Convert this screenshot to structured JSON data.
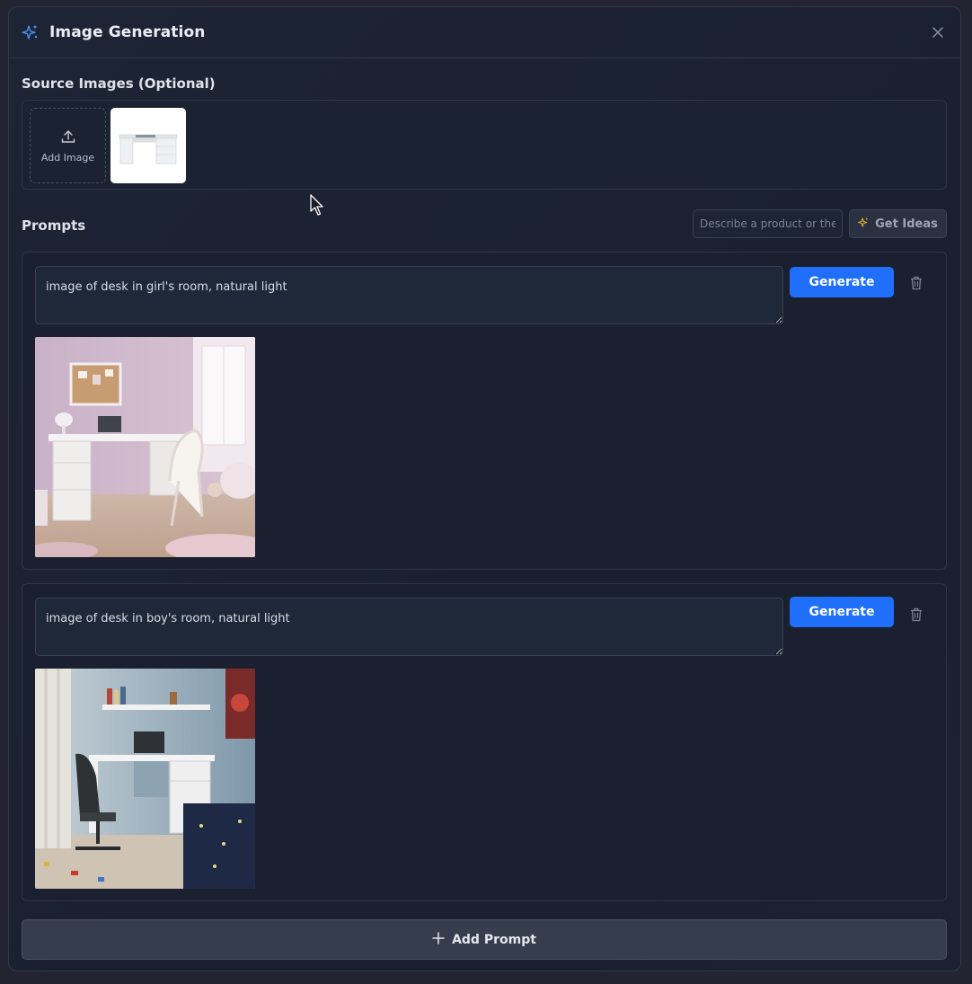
{
  "dialog": {
    "title": "Image Generation",
    "source_label": "Source Images (Optional)",
    "add_image_label": "Add Image",
    "prompts_label": "Prompts",
    "ideas_placeholder": "Describe a product or theme",
    "get_ideas_label": "Get Ideas",
    "add_prompt_label": "Add Prompt"
  },
  "source_images": [
    {
      "alt": "white desk product photo"
    }
  ],
  "prompts": [
    {
      "text": "image of desk in girl's room, natural light",
      "generate_label": "Generate",
      "result_alt": "desk in girl's room"
    },
    {
      "text": "image of desk in boy's room, natural light",
      "generate_label": "Generate",
      "result_alt": "desk in boy's room"
    }
  ],
  "icons": [
    "sparkle-icon",
    "close-icon",
    "upload-icon",
    "trash-icon",
    "plus-icon",
    "cursor-icon"
  ],
  "colors": {
    "accent": "#1f6ffb",
    "sparkle": "#4f8ef7",
    "ideas_sparkle": "#d6a637"
  }
}
